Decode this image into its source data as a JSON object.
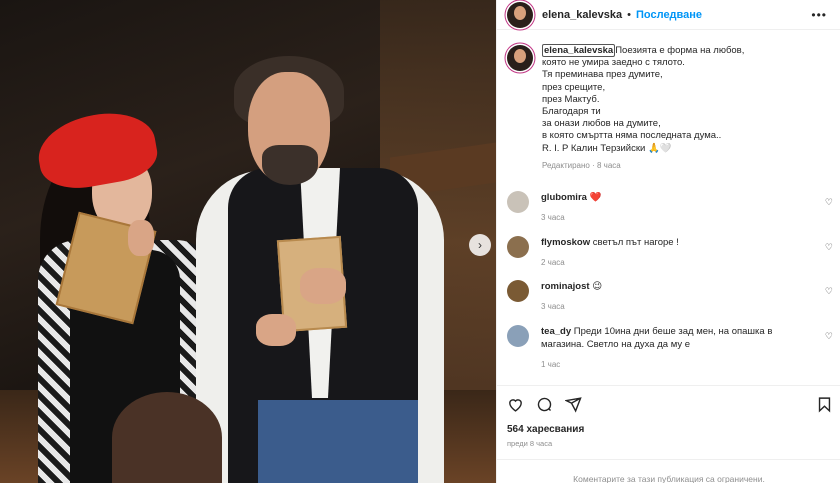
{
  "post": {
    "username": "elena_kalevska",
    "separator": "•",
    "follow_label": "Последване",
    "more_label": "•••"
  },
  "caption": {
    "username": "elena_kalevska",
    "lines": [
      "Поезията е форма на любов,",
      "която не умира заедно с тялото.",
      "Тя преминава през думите,",
      "през срещите,",
      "през Мактуб.",
      "Благодаря ти",
      "за онази любов на думите,",
      "в която смъртта няма последната дума..",
      "R. I. P Калин Терзийски 🙏🤍"
    ],
    "meta": "Редактирано · 8 часа"
  },
  "comments": [
    {
      "username": "glubomira",
      "text": "❤️",
      "time": "3 часа",
      "avatar_color": "#c9c2b8"
    },
    {
      "username": "flymoskow",
      "text": "светъл път нагоре !",
      "time": "2 часа",
      "avatar_color": "#8b6f4e"
    },
    {
      "username": "rominajost",
      "text": "😉",
      "time": "3 часа",
      "avatar_color": "#7a5a34"
    },
    {
      "username": "tea_dy",
      "text": "Преди 10ина дни беше зад мен, на опашка в магазина. Светло на духа да му е",
      "time": "1 час",
      "avatar_color": "#8aa0b8"
    }
  ],
  "actions": {
    "likes": "564 харесвания",
    "ago": "преди 8 часа",
    "restricted": "Коментарите за тази публикация са ограничени."
  },
  "icons": {
    "like": "heart-icon",
    "comment": "comment-icon",
    "share": "send-icon",
    "save": "bookmark-icon",
    "next": "chevron-right-icon",
    "comment_like": "heart-outline-icon"
  },
  "colors": {
    "follow": "#0095f6",
    "heart_red": "#ed4956",
    "muted": "#8e8e8e"
  }
}
